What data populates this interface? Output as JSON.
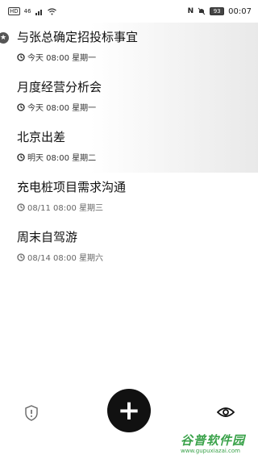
{
  "status_bar": {
    "left_text": "HD",
    "signal": "46",
    "nfc": "N",
    "battery": "93",
    "time": "00:07"
  },
  "tasks": [
    {
      "title": "与张总确定招投标事宜",
      "meta": "今天 08:00 星期一",
      "starred": true
    },
    {
      "title": "月度经营分析会",
      "meta": "今天 08:00 星期一",
      "starred": false
    },
    {
      "title": "北京出差",
      "meta": "明天 08:00 星期二",
      "starred": false
    },
    {
      "title": "充电桩项目需求沟通",
      "meta": "08/11 08:00 星期三",
      "starred": false
    },
    {
      "title": "周末自驾游",
      "meta": "08/14 08:00 星期六",
      "starred": false
    }
  ],
  "bottom_bar": {
    "add_label": "+"
  },
  "watermark": {
    "title": "谷普软件园",
    "url": "www.gupuxiazai.com"
  },
  "icons": {
    "star": "star-icon",
    "clock": "clock-icon",
    "shield": "shield-alert-icon",
    "eye": "eye-icon",
    "add": "plus-icon"
  },
  "colors": {
    "fab": "#111111",
    "watermark": "#3aa24a"
  }
}
